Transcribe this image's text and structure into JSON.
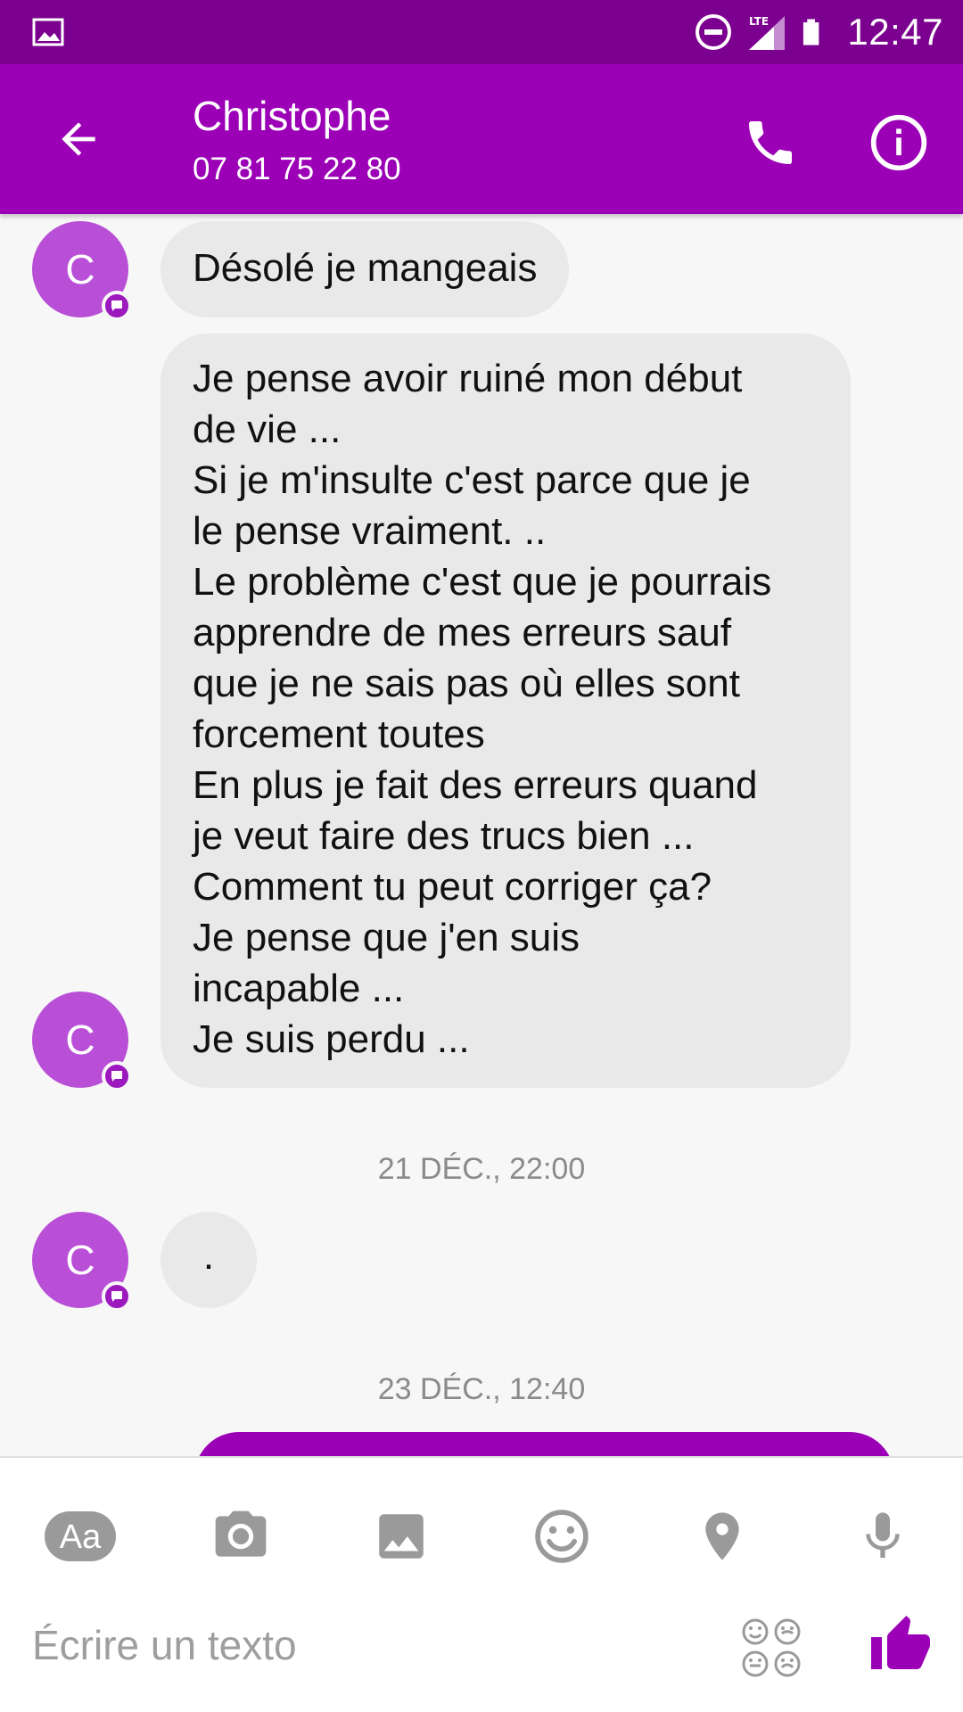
{
  "status_bar": {
    "time": "12:47",
    "network_label": "LTE",
    "icons": [
      "image-icon",
      "do-not-disturb-icon",
      "lte-signal-icon",
      "battery-icon"
    ]
  },
  "header": {
    "contact_name": "Christophe",
    "contact_phone": "07 81 75 22 80",
    "icons": [
      "back-arrow-icon",
      "phone-icon",
      "info-icon"
    ]
  },
  "messages": {
    "avatar_initial": "C",
    "message_1": "Désolé je mangeais",
    "message_2": "Je pense avoir ruiné mon début\nde vie ...\nSi je m'insulte c'est parce que je\nle pense vraiment. ..\nLe problème c'est que je pourrais\napprendre de mes erreurs sauf\nque je ne sais pas où elles sont\nforcement toutes\nEn plus je fait des erreurs quand\nje veut faire des trucs bien ...\nComment tu peut corriger ça?\nJe pense que j'en suis\nincapable ...\nJe suis perdu ...",
    "date_1": "21 DÉC., 22:00",
    "message_3": ".",
    "date_2": "23 DÉC., 12:40"
  },
  "composer": {
    "aa_label": "Aa",
    "placeholder": "Écrire un texto",
    "tools": [
      "text-format-icon",
      "camera-icon",
      "gallery-icon",
      "emoji-icon",
      "location-pin-icon",
      "microphone-icon"
    ],
    "actions": [
      "emoji-grid-icon",
      "thumbs-up-icon"
    ]
  },
  "colors": {
    "status_bar": "#7c008f",
    "header": "#9b00b6",
    "avatar": "#b84fd6",
    "bubble_incoming": "#e9e9e9",
    "icon_gray": "#9a9a9a"
  }
}
